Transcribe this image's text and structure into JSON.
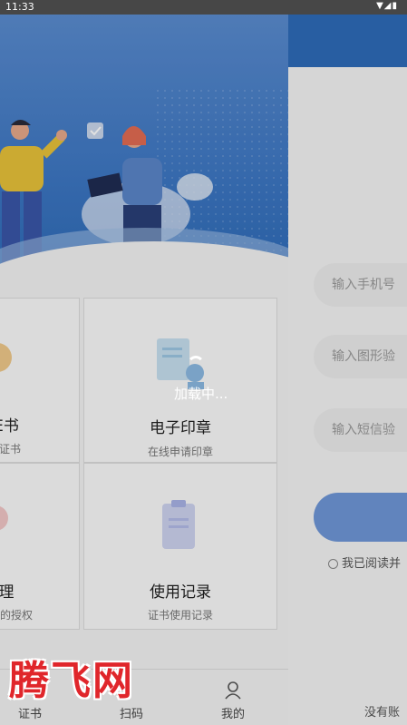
{
  "status_bar": {
    "time": "11:33",
    "icons": "▼◢▮"
  },
  "services": {
    "top_left": {
      "title": "证书",
      "title_visible": "E书",
      "subtitle": "证书",
      "subtitle_visible": "证书"
    },
    "top_right": {
      "title": "电子印章",
      "subtitle": "在线申请印章"
    },
    "bottom_left": {
      "title_visible": "理",
      "subtitle_visible": "的授权"
    },
    "bottom_right": {
      "title": "使用记录",
      "subtitle": "证书使用记录"
    }
  },
  "loading": {
    "text": "加载中..."
  },
  "login": {
    "phone_placeholder": "输入手机号",
    "captcha_placeholder": "输入图形验",
    "sms_placeholder": "输入短信验",
    "agree_text": "我已阅读并",
    "no_account": "没有账"
  },
  "bottom_nav": {
    "tab1": "证书",
    "tab2": "扫码",
    "tab3": "我的"
  },
  "watermark": "腾飞网",
  "colors": {
    "primary": "#2e6bb9",
    "watermark": "#e0262b"
  }
}
